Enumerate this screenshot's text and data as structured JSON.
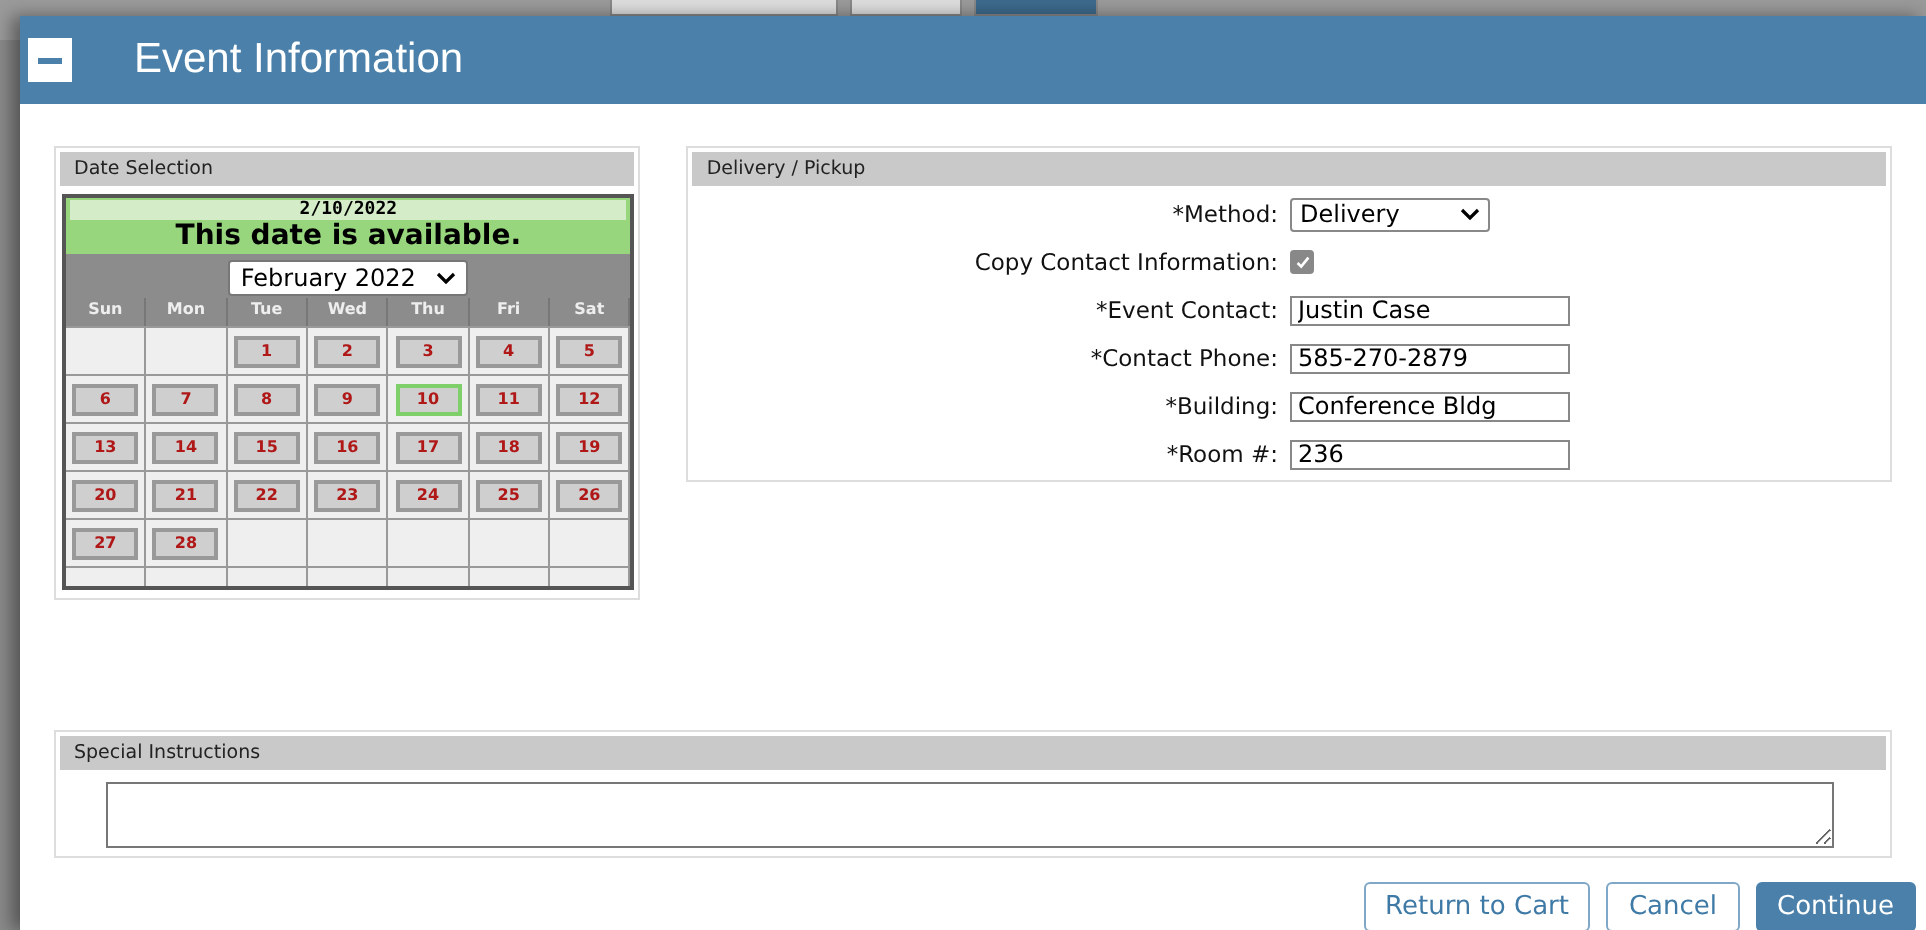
{
  "background_buttons": [
    {
      "kind": "plain"
    },
    {
      "kind": "plain"
    },
    {
      "kind": "primary"
    }
  ],
  "window": {
    "title": "Event Information"
  },
  "date_selection": {
    "title": "Date Selection",
    "selected_date": "2/10/2022",
    "status": "This date is available.",
    "month": "February 2022",
    "weekdays": [
      "Sun",
      "Mon",
      "Tue",
      "Wed",
      "Thu",
      "Fri",
      "Sat"
    ],
    "weeks": [
      [
        {
          "kind": "empty"
        },
        {
          "kind": "empty"
        },
        {
          "kind": "day",
          "day": "1",
          "selected": false
        },
        {
          "kind": "day",
          "day": "2",
          "selected": false
        },
        {
          "kind": "day",
          "day": "3",
          "selected": false
        },
        {
          "kind": "day",
          "day": "4",
          "selected": false
        },
        {
          "kind": "day",
          "day": "5",
          "selected": false
        }
      ],
      [
        {
          "kind": "day",
          "day": "6",
          "selected": false
        },
        {
          "kind": "day",
          "day": "7",
          "selected": false
        },
        {
          "kind": "day",
          "day": "8",
          "selected": false
        },
        {
          "kind": "day",
          "day": "9",
          "selected": false
        },
        {
          "kind": "day",
          "day": "10",
          "selected": true
        },
        {
          "kind": "day",
          "day": "11",
          "selected": false
        },
        {
          "kind": "day",
          "day": "12",
          "selected": false
        }
      ],
      [
        {
          "kind": "day",
          "day": "13",
          "selected": false
        },
        {
          "kind": "day",
          "day": "14",
          "selected": false
        },
        {
          "kind": "day",
          "day": "15",
          "selected": false
        },
        {
          "kind": "day",
          "day": "16",
          "selected": false
        },
        {
          "kind": "day",
          "day": "17",
          "selected": false
        },
        {
          "kind": "day",
          "day": "18",
          "selected": false
        },
        {
          "kind": "day",
          "day": "19",
          "selected": false
        }
      ],
      [
        {
          "kind": "day",
          "day": "20",
          "selected": false
        },
        {
          "kind": "day",
          "day": "21",
          "selected": false
        },
        {
          "kind": "day",
          "day": "22",
          "selected": false
        },
        {
          "kind": "day",
          "day": "23",
          "selected": false
        },
        {
          "kind": "day",
          "day": "24",
          "selected": false
        },
        {
          "kind": "day",
          "day": "25",
          "selected": false
        },
        {
          "kind": "day",
          "day": "26",
          "selected": false
        }
      ],
      [
        {
          "kind": "day",
          "day": "27",
          "selected": false
        },
        {
          "kind": "day",
          "day": "28",
          "selected": false
        },
        {
          "kind": "empty"
        },
        {
          "kind": "empty"
        },
        {
          "kind": "empty"
        },
        {
          "kind": "empty"
        },
        {
          "kind": "empty"
        }
      ],
      [
        {
          "kind": "empty"
        },
        {
          "kind": "empty"
        },
        {
          "kind": "empty"
        },
        {
          "kind": "empty"
        },
        {
          "kind": "empty"
        },
        {
          "kind": "empty"
        },
        {
          "kind": "empty"
        }
      ]
    ]
  },
  "delivery": {
    "title": "Delivery / Pickup",
    "fields": [
      {
        "kind": "select",
        "label": "*Method:",
        "value": "Delivery"
      },
      {
        "kind": "checkbox",
        "label": "Copy Contact Information:",
        "checked": true
      },
      {
        "kind": "text",
        "label": "*Event Contact:",
        "value": "Justin Case"
      },
      {
        "kind": "text",
        "label": "*Contact Phone:",
        "value": "585-270-2879"
      },
      {
        "kind": "text",
        "label": "*Building:",
        "value": "Conference Bldg"
      },
      {
        "kind": "text",
        "label": "*Room #:",
        "value": "236"
      }
    ]
  },
  "special_instructions": {
    "title": "Special Instructions"
  },
  "buttons": [
    {
      "label": "Return to Cart",
      "kind": "plain"
    },
    {
      "label": "Cancel",
      "kind": "plain"
    },
    {
      "label": "Continue",
      "kind": "primary"
    }
  ]
}
